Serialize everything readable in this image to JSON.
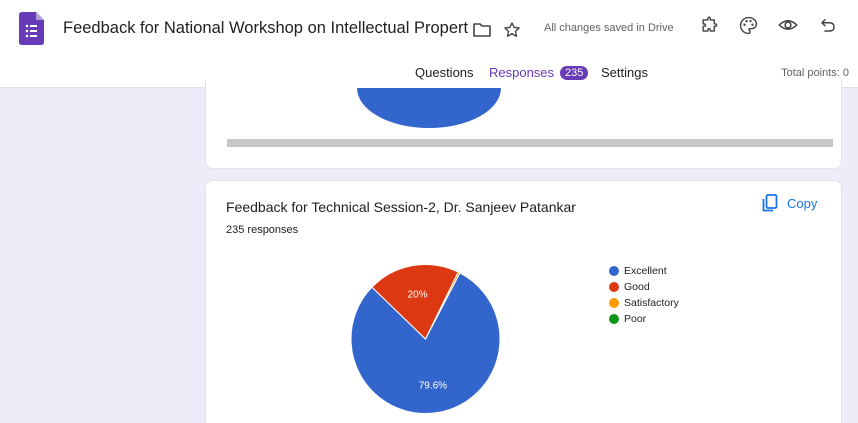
{
  "app": {
    "title": "Feedback  for National Workshop on Intellectual Property Rig",
    "save_status": "All changes saved in Drive",
    "icons": [
      "forms-icon",
      "folder-icon",
      "star-icon",
      "addon-icon",
      "palette-icon",
      "preview-eye-icon",
      "undo-icon"
    ]
  },
  "tabs": [
    {
      "label": "Questions"
    },
    {
      "label": "Responses",
      "badge": "235",
      "active": true
    },
    {
      "label": "Settings"
    }
  ],
  "total_points": "Total points: 0",
  "question": {
    "title": "Feedback for Technical Session-2, Dr. Sanjeev Patankar",
    "responses": "235 responses",
    "copy_label": "Copy"
  },
  "colors": {
    "accent": "#673ab7",
    "link": "#1a73e8"
  },
  "chart_data": {
    "type": "pie",
    "categories": [
      "Excellent",
      "Good",
      "Satisfactory",
      "Poor"
    ],
    "values": [
      79.6,
      20,
      0.4,
      0
    ],
    "labels": [
      "79.6%",
      "20%",
      "",
      ""
    ],
    "colors": [
      "#3366cc",
      "#dc3912",
      "#ff9900",
      "#109618"
    ],
    "legend": "right"
  }
}
